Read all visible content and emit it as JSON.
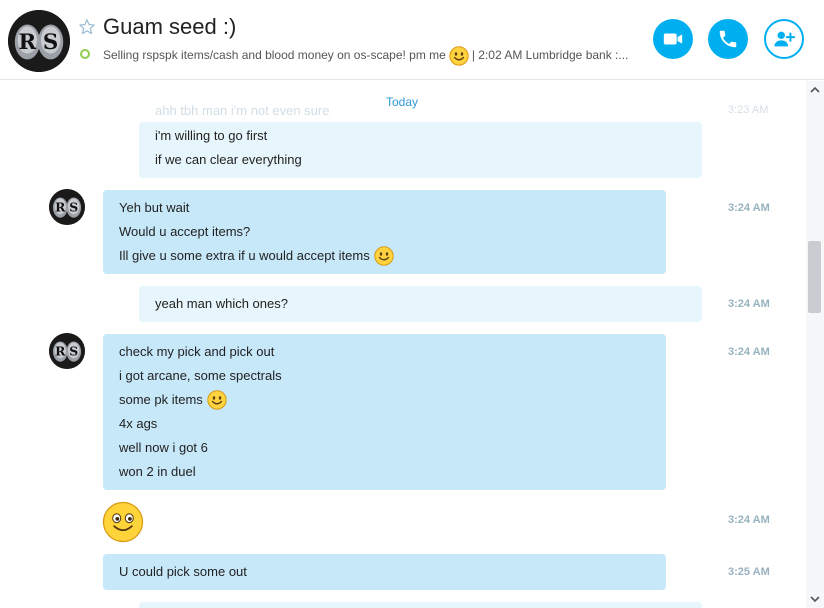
{
  "header": {
    "title": "Guam seed :)",
    "mood_text": "Selling rspspk items/cash and blood money on os-scape!  pm me",
    "mood_suffix": "| 2:02 AM Lumbridge bank :...",
    "avatar_text": "RS",
    "buttons": {
      "video": "video-call",
      "call": "audio-call",
      "add": "add-participant"
    }
  },
  "conversation": {
    "date_divider": "Today",
    "ghost_text": "ahh tbh man i'm not even sure",
    "ghost_time": "3:23 AM",
    "messages": [
      {
        "side": "out",
        "lines": [
          "i'm willing to go first",
          "if we can clear everything"
        ],
        "time": ""
      },
      {
        "side": "in",
        "lines": [
          "Yeh but wait",
          "Would u accept items?",
          "Ill give u some extra if u would accept items"
        ],
        "time": "3:24 AM"
      },
      {
        "side": "out",
        "lines": [
          "yeah man which ones?"
        ],
        "time": "3:24 AM"
      },
      {
        "side": "in",
        "lines": [
          "check my pick and pick out",
          "i got arcane, some spectrals",
          "some pk items",
          "4x ags",
          "well now i got 6",
          "won 2 in duel"
        ],
        "time": "3:24 AM"
      },
      {
        "side": "in",
        "lines": [],
        "emoticon": "big-smile",
        "time": "3:24 AM"
      },
      {
        "side": "in",
        "lines": [
          "U could pick some out"
        ],
        "time": "3:25 AM"
      }
    ]
  },
  "colors": {
    "accent": "#00aff0",
    "incoming_bubble": "#c7e8f9",
    "outgoing_bubble": "#e7f5fc",
    "timestamp": "#99b2c0",
    "today": "#2f9ad6",
    "presence": "#8fce4c"
  }
}
